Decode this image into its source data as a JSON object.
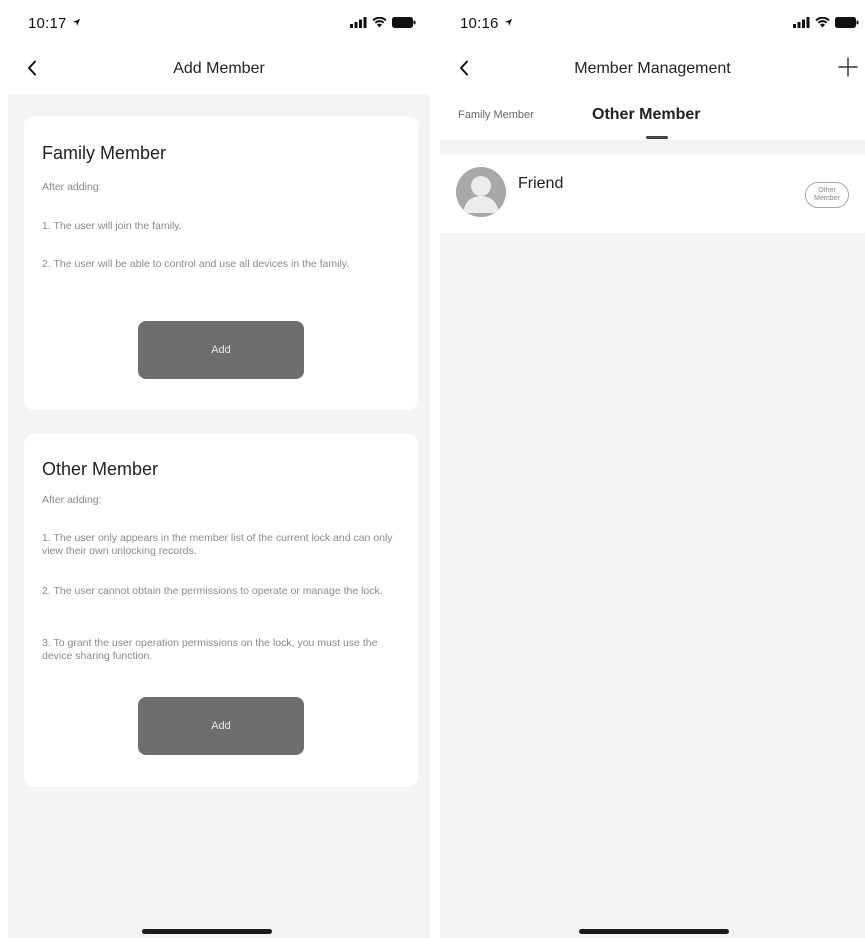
{
  "left_screen": {
    "status": {
      "time": "10:17"
    },
    "nav": {
      "title": "Add Member"
    },
    "family_card": {
      "title": "Family Member",
      "intro": "After adding:",
      "point1": "1. The user will join the family.",
      "point2": "2. The user will be able to control and use all devices in the family.",
      "button_label": "Add"
    },
    "other_card": {
      "title": "Other Member",
      "intro": "After adding:",
      "point1": "1. The user only appears in the member list of the current lock and can only view their own unlocking records.",
      "point2": "2. The user cannot obtain the permissions to operate or manage the lock.",
      "point3": "3. To grant the user operation permissions on the lock, you must use the device sharing function.",
      "button_label": "Add"
    }
  },
  "right_screen": {
    "status": {
      "time": "10:16"
    },
    "nav": {
      "title": "Member Management"
    },
    "tabs": [
      {
        "label": "Family Member",
        "active": false
      },
      {
        "label": "Other Member",
        "active": true
      }
    ],
    "members": [
      {
        "name": "Friend",
        "badge": "Other Member"
      }
    ]
  },
  "icons": {
    "back": "chevron-left-icon",
    "plus": "plus-icon",
    "location": "location-arrow-icon",
    "signal": "cellular-signal-icon",
    "wifi": "wifi-icon",
    "battery": "battery-icon",
    "avatar": "user-avatar-icon"
  },
  "colors": {
    "background": "#f4f4f4",
    "card": "#ffffff",
    "button": "#6e6e6e",
    "button_text": "#e6e6e6"
  }
}
